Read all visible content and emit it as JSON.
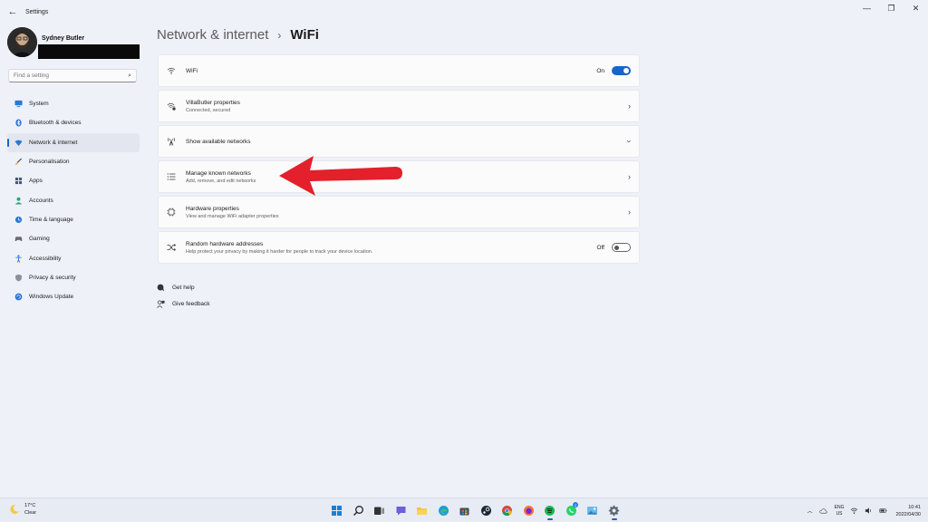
{
  "window": {
    "title": "Settings"
  },
  "profile": {
    "name": "Sydney Butler"
  },
  "search": {
    "placeholder": "Find a setting"
  },
  "nav": {
    "items": [
      {
        "label": "System"
      },
      {
        "label": "Bluetooth & devices"
      },
      {
        "label": "Network & internet"
      },
      {
        "label": "Personalisation"
      },
      {
        "label": "Apps"
      },
      {
        "label": "Accounts"
      },
      {
        "label": "Time & language"
      },
      {
        "label": "Gaming"
      },
      {
        "label": "Accessibility"
      },
      {
        "label": "Privacy & security"
      },
      {
        "label": "Windows Update"
      }
    ]
  },
  "breadcrumb": {
    "parent": "Network & internet",
    "separator": "›",
    "current": "WiFi"
  },
  "cards": [
    {
      "title": "WiFi",
      "subtitle": "",
      "toggle_label": "On",
      "toggle_state": "on",
      "icon": "wifi-icon"
    },
    {
      "title": "VillaButler properties",
      "subtitle": "Connected, secured",
      "icon": "wifi-secured-icon"
    },
    {
      "title": "Show available networks",
      "subtitle": "",
      "icon": "antenna-icon"
    },
    {
      "title": "Manage known networks",
      "subtitle": "Add, remove, and edit networks",
      "icon": "list-icon"
    },
    {
      "title": "Hardware properties",
      "subtitle": "View and manage WiFi adapter properties",
      "icon": "chip-icon"
    },
    {
      "title": "Random hardware addresses",
      "subtitle": "Help protect your privacy by making it harder for people to track your device location.",
      "toggle_label": "Off",
      "toggle_state": "off",
      "icon": "shuffle-icon"
    }
  ],
  "links": [
    {
      "label": "Get help"
    },
    {
      "label": "Give feedback"
    }
  ],
  "taskbar": {
    "weather": {
      "temp": "17°C",
      "condition": "Clear"
    },
    "badge_count": "2",
    "tray": {
      "lang_top": "ENG",
      "lang_bottom": "US",
      "time": "10:41",
      "date": "2022/04/30"
    }
  },
  "colors": {
    "accent": "#1a64c9",
    "arrow": "#e3202b",
    "background": "#eef1f8"
  }
}
